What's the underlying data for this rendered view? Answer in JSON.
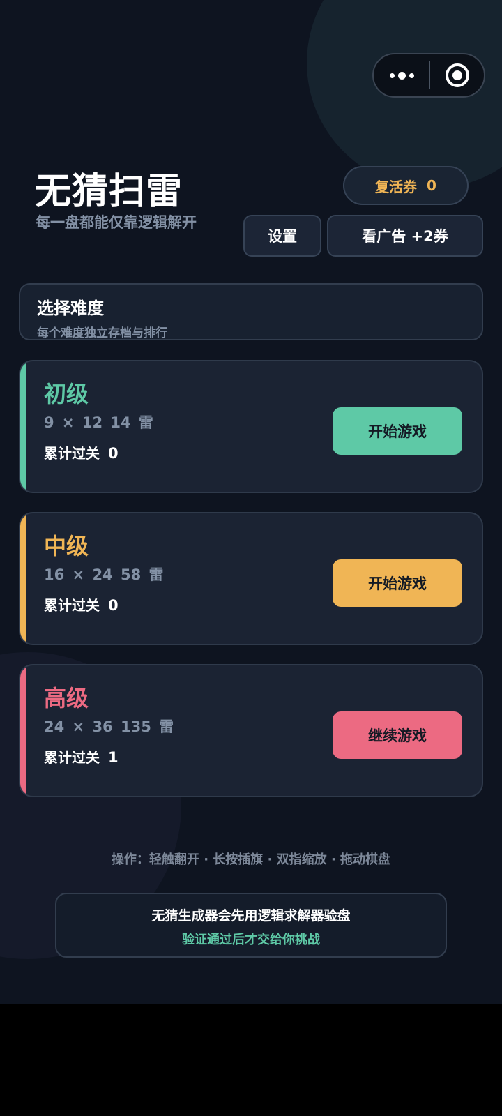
{
  "header": {
    "title": "无猜扫雷",
    "subtitle": "每一盘都能仅靠逻辑解开",
    "ticket_label": "复活券",
    "ticket_count": "0",
    "settings_label": "设置",
    "ad_label": "看广告 +2券"
  },
  "difficulty": {
    "title": "选择难度",
    "subtitle": "每个难度独立存档与排行"
  },
  "levels": [
    {
      "name": "初级",
      "spec": "9 × 12   14 雷",
      "stat_label": "累计过关",
      "stat_value": "0",
      "button": "开始游戏",
      "color": "#5ec9a6"
    },
    {
      "name": "中级",
      "spec": "16 × 24   58 雷",
      "stat_label": "累计过关",
      "stat_value": "0",
      "button": "开始游戏",
      "color": "#f0b555"
    },
    {
      "name": "高级",
      "spec": "24 × 36   135 雷",
      "stat_label": "累计过关",
      "stat_value": "1",
      "button": "继续游戏",
      "color": "#ec6a82"
    }
  ],
  "hint": "操作：轻触翻开 · 长按插旗 · 双指缩放 · 拖动棋盘",
  "note": {
    "line1": "无猜生成器会先用逻辑求解器验盘",
    "line2": "验证通过后才交给你挑战"
  },
  "capsule": {
    "more_icon": "more-dots-icon",
    "close_icon": "target-close-icon"
  }
}
